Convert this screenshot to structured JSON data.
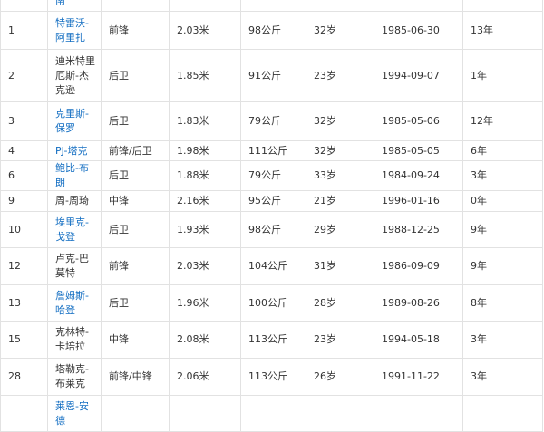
{
  "roster": {
    "rows": [
      {
        "number": "",
        "name": "南",
        "linked": true,
        "position": "",
        "height": "",
        "weight": "",
        "age": "",
        "birthdate": "",
        "experience": "",
        "h": 24
      },
      {
        "number": "1",
        "name": "特雷沃-阿里扎",
        "linked": true,
        "position": "前锋",
        "height": "2.03米",
        "weight": "98公斤",
        "age": "32岁",
        "birthdate": "1985-06-30",
        "experience": "13年",
        "h": 42
      },
      {
        "number": "2",
        "name": "迪米特里厄斯-杰克逊",
        "linked": false,
        "position": "后卫",
        "height": "1.85米",
        "weight": "91公斤",
        "age": "23岁",
        "birthdate": "1994-09-07",
        "experience": "1年",
        "h": 58
      },
      {
        "number": "3",
        "name": "克里斯-保罗",
        "linked": true,
        "position": "后卫",
        "height": "1.83米",
        "weight": "79公斤",
        "age": "32岁",
        "birthdate": "1985-05-06",
        "experience": "12年",
        "h": 43
      },
      {
        "number": "4",
        "name": "PJ-塔克",
        "linked": true,
        "position": "前锋/后卫",
        "height": "1.98米",
        "weight": "111公斤",
        "age": "32岁",
        "birthdate": "1985-05-05",
        "experience": "6年",
        "h": 22
      },
      {
        "number": "6",
        "name": "鲍比-布朗",
        "linked": true,
        "position": "后卫",
        "height": "1.88米",
        "weight": "79公斤",
        "age": "33岁",
        "birthdate": "1984-09-24",
        "experience": "3年",
        "h": 22
      },
      {
        "number": "9",
        "name": "周-周琦",
        "linked": false,
        "position": "中锋",
        "height": "2.16米",
        "weight": "95公斤",
        "age": "21岁",
        "birthdate": "1996-01-16",
        "experience": "0年",
        "h": 23
      },
      {
        "number": "10",
        "name": "埃里克-戈登",
        "linked": true,
        "position": "后卫",
        "height": "1.93米",
        "weight": "98公斤",
        "age": "29岁",
        "birthdate": "1988-12-25",
        "experience": "9年",
        "h": 40
      },
      {
        "number": "12",
        "name": "卢克-巴莫特",
        "linked": false,
        "position": "前锋",
        "height": "2.03米",
        "weight": "104公斤",
        "age": "31岁",
        "birthdate": "1986-09-09",
        "experience": "9年",
        "h": 41
      },
      {
        "number": "13",
        "name": "詹姆斯-哈登",
        "linked": true,
        "position": "后卫",
        "height": "1.96米",
        "weight": "100公斤",
        "age": "28岁",
        "birthdate": "1989-08-26",
        "experience": "8年",
        "h": 40
      },
      {
        "number": "15",
        "name": "克林特-卡培拉",
        "linked": false,
        "position": "中锋",
        "height": "2.08米",
        "weight": "113公斤",
        "age": "23岁",
        "birthdate": "1994-05-18",
        "experience": "3年",
        "h": 41
      },
      {
        "number": "28",
        "name": "塔勒克-布莱克",
        "linked": false,
        "position": "前锋/中锋",
        "height": "2.06米",
        "weight": "113公斤",
        "age": "26岁",
        "birthdate": "1991-11-22",
        "experience": "3年",
        "h": 41
      },
      {
        "number": "",
        "name": "莱恩-安德",
        "linked": true,
        "position": "",
        "height": "",
        "weight": "",
        "age": "",
        "birthdate": "",
        "experience": "",
        "h": 40
      }
    ]
  }
}
